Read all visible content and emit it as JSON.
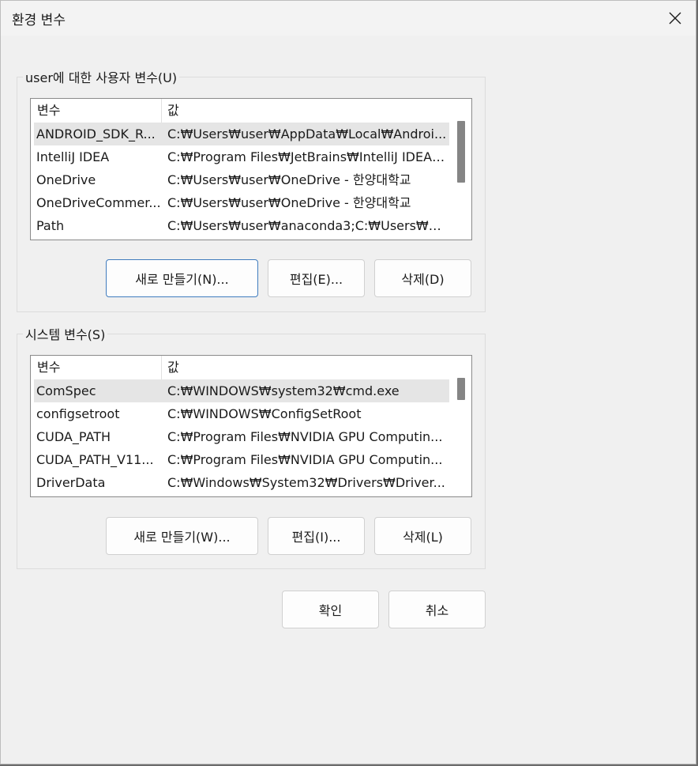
{
  "window": {
    "title": "환경 변수"
  },
  "user_vars": {
    "group_label": "user에 대한 사용자 변수(U)",
    "col_name": "변수",
    "col_value": "값",
    "rows": [
      {
        "name": "ANDROID_SDK_R...",
        "value": "C:₩Users₩user₩AppData₩Local₩Androi..."
      },
      {
        "name": "IntelliJ IDEA",
        "value": "C:₩Program Files₩JetBrains₩IntelliJ IDEA ..."
      },
      {
        "name": "OneDrive",
        "value": "C:₩Users₩user₩OneDrive - 한양대학교"
      },
      {
        "name": "OneDriveCommer...",
        "value": "C:₩Users₩user₩OneDrive - 한양대학교"
      },
      {
        "name": "Path",
        "value": "C:₩Users₩user₩anaconda3;C:₩Users₩us..."
      }
    ],
    "new_label": "새로 만들기(N)...",
    "edit_label": "편집(E)...",
    "delete_label": "삭제(D)"
  },
  "system_vars": {
    "group_label": "시스템 변수(S)",
    "col_name": "변수",
    "col_value": "값",
    "rows": [
      {
        "name": "ComSpec",
        "value": "C:₩WINDOWS₩system32₩cmd.exe"
      },
      {
        "name": "configsetroot",
        "value": "C:₩WINDOWS₩ConfigSetRoot"
      },
      {
        "name": "CUDA_PATH",
        "value": "C:₩Program Files₩NVIDIA GPU Computin..."
      },
      {
        "name": "CUDA_PATH_V11...",
        "value": "C:₩Program Files₩NVIDIA GPU Computin..."
      },
      {
        "name": "DriverData",
        "value": "C:₩Windows₩System32₩Drivers₩Driver..."
      }
    ],
    "new_label": "새로 만들기(W)...",
    "edit_label": "편집(I)...",
    "delete_label": "삭제(L)"
  },
  "footer": {
    "ok_label": "확인",
    "cancel_label": "취소"
  },
  "icons": {
    "close": "close-icon"
  }
}
